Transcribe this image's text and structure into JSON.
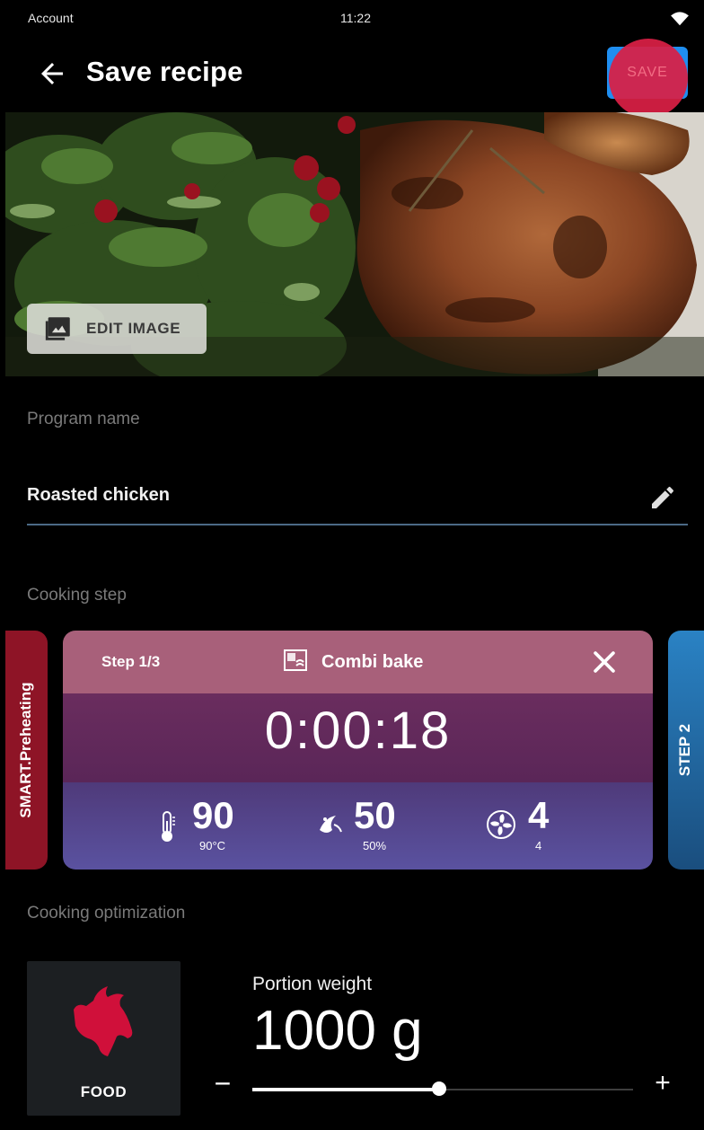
{
  "status_bar": {
    "left_label": "Account",
    "time": "11:22"
  },
  "header": {
    "title": "Save recipe",
    "save_label": "SAVE"
  },
  "hero": {
    "edit_image_label": "EDIT IMAGE"
  },
  "program_name": {
    "label": "Program name",
    "value": "Roasted chicken"
  },
  "cooking_step": {
    "label": "Cooking step",
    "prev_card_label": "SMART.Preheating",
    "next_card_label": "STEP 2",
    "step": "Step 1/3",
    "mode": "Combi bake",
    "timer": "0:00:18",
    "temperature": {
      "value": "90",
      "sub": "90°C"
    },
    "humidity": {
      "value": "50",
      "sub": "50%"
    },
    "fan": {
      "value": "4",
      "sub": "4"
    }
  },
  "optimization": {
    "label": "Cooking optimization",
    "food_label": "FOOD",
    "portion_label": "Portion weight",
    "portion_value": "1000 g",
    "slider_fraction": 0.49,
    "minus": "−",
    "plus": "+"
  },
  "colors": {
    "accent": "#1f8ef0",
    "save_highlight": "#d91f45",
    "food_icon": "#d0103a"
  },
  "icons": [
    "back-arrow-icon",
    "wifi-icon",
    "image-icon",
    "pencil-icon",
    "combi-bake-icon",
    "close-icon",
    "thermometer-icon",
    "humidity-icon",
    "fan-icon",
    "cow-icon"
  ]
}
